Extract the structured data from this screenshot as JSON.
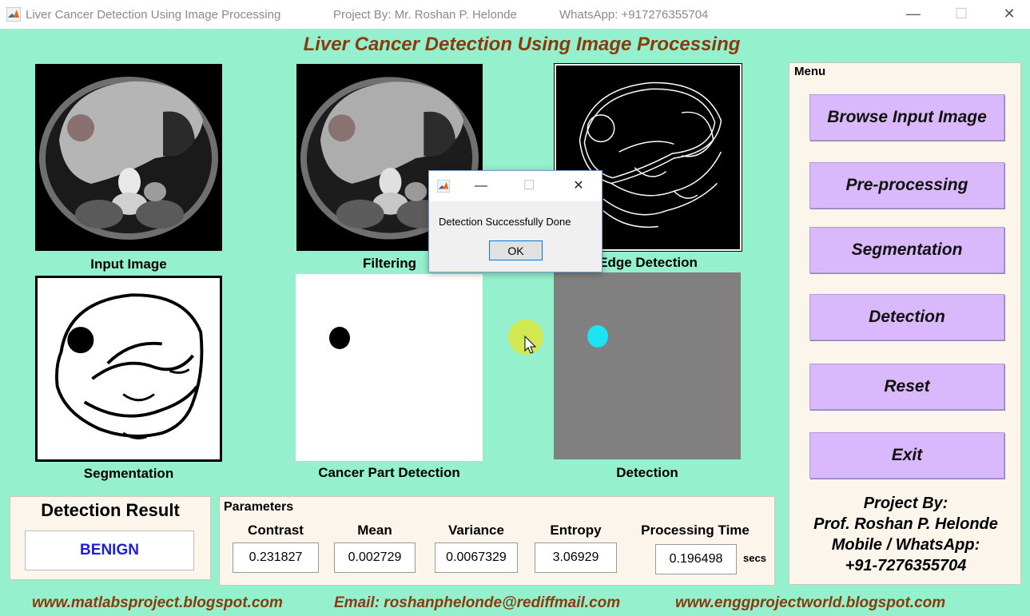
{
  "window": {
    "title": "Liver Cancer Detection Using Image Processing",
    "project_by": "Project By: Mr. Roshan P. Helonde",
    "whatsapp": "WhatsApp: +917276355704",
    "min_glyph": "—",
    "max_glyph": "☐",
    "close_glyph": "✕"
  },
  "header": {
    "title": "Liver Cancer Detection Using Image Processing"
  },
  "panels": {
    "input_label": "Input Image",
    "filtering_label": "Filtering",
    "edge_label": "Edge Detection",
    "segmentation_label": "Segmentation",
    "cancer_part_label": "Cancer Part Detection",
    "detection_label": "Detection"
  },
  "menu": {
    "legend": "Menu",
    "buttons": {
      "browse": "Browse Input Image",
      "preprocessing": "Pre-processing",
      "segmentation": "Segmentation",
      "detection": "Detection",
      "reset": "Reset",
      "exit": "Exit"
    },
    "credits": {
      "line1": "Project By:",
      "line2": "Prof. Roshan P. Helonde",
      "line3": "Mobile / WhatsApp:",
      "line4": "+91-7276355704"
    }
  },
  "result": {
    "title": "Detection Result",
    "value": "BENIGN",
    "value_color": "#1f1fd0"
  },
  "parameters": {
    "legend": "Parameters",
    "contrast": {
      "label": "Contrast",
      "value": "0.231827"
    },
    "mean": {
      "label": "Mean",
      "value": "0.002729"
    },
    "variance": {
      "label": "Variance",
      "value": "0.0067329"
    },
    "entropy": {
      "label": "Entropy",
      "value": "3.06929"
    },
    "processing_time": {
      "label": "Processing Time",
      "value": "0.196498",
      "unit": "secs"
    }
  },
  "footer": {
    "site1": "www.matlabsproject.blogspot.com",
    "email": "Email: roshanphelonde@rediffmail.com",
    "site2": "www.enggprojectworld.blogspot.com"
  },
  "dialog": {
    "message": "Detection Successfully Done",
    "ok": "OK",
    "min_glyph": "—",
    "max_glyph": "☐",
    "close_glyph": "✕"
  },
  "colors": {
    "figure_bg": "#95f0ce",
    "title_color": "#8b3a0f",
    "button_bg": "#d9b8fb",
    "panel_bg": "#fbf5ec",
    "tumor_cyan": "#1ee3f5"
  }
}
